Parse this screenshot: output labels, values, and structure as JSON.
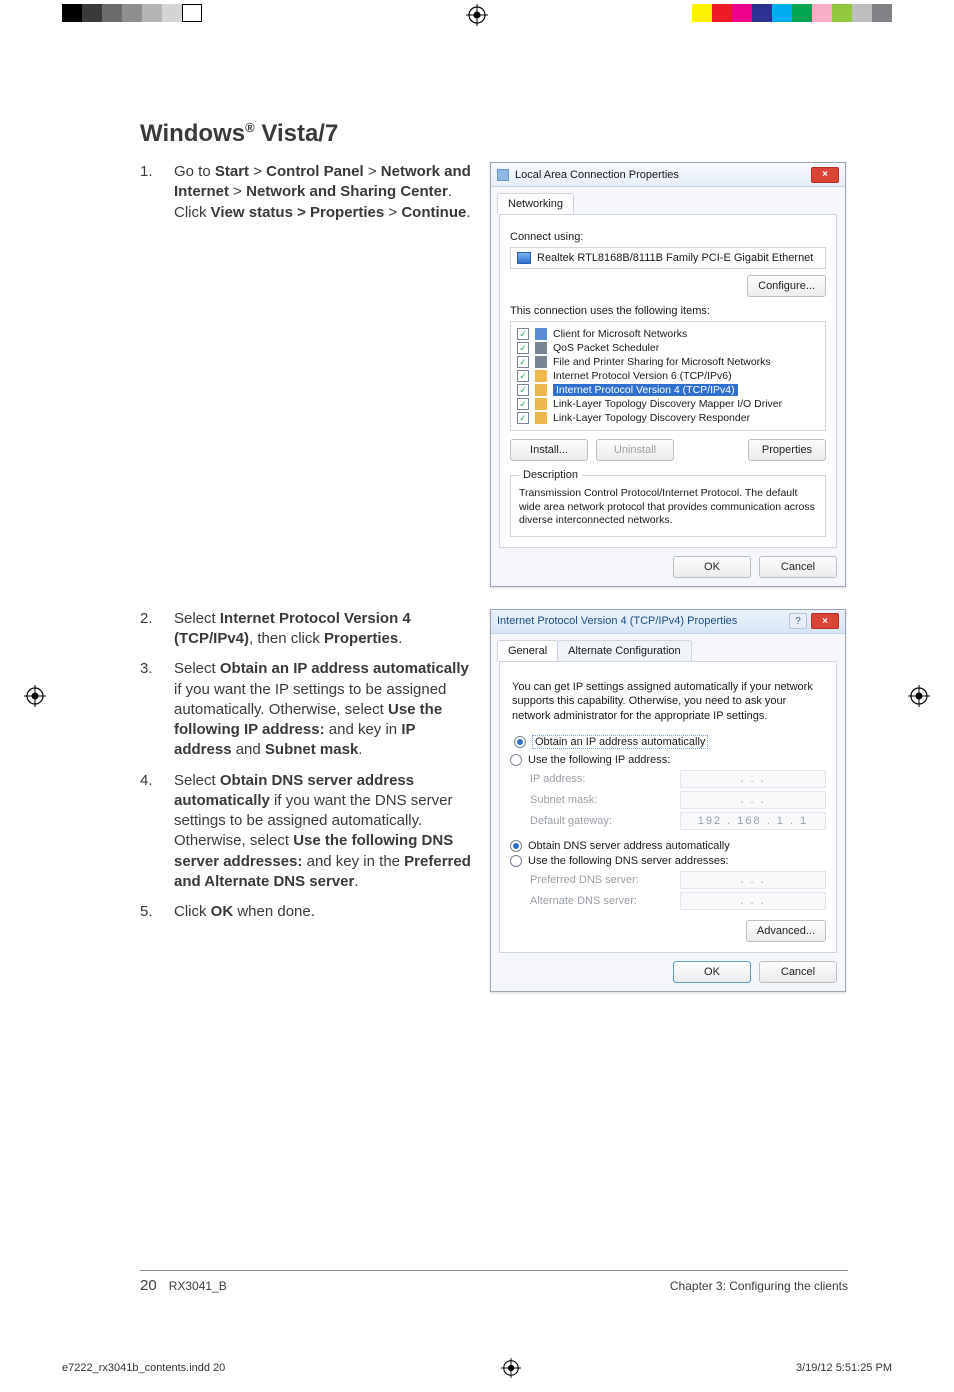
{
  "heading": {
    "text_pre": "Windows",
    "reg": "®",
    "text_post": " Vista/7"
  },
  "steps": [
    {
      "pre": "Go to ",
      "seq": [
        "Start",
        " > ",
        "Control Panel",
        " > ",
        "Network and Internet",
        " > ",
        "Network and Sharing Center"
      ],
      "post1": ". Click ",
      "b1": "View status > Properties",
      "post2": " > ",
      "b2": "Continue",
      "tail": "."
    },
    {
      "pre": "Select ",
      "b1": "Internet Protocol Version 4 (TCP/IPv4)",
      "mid": ", then click ",
      "b2": "Properties",
      "tail": "."
    },
    {
      "pre": "Select ",
      "b1": "Obtain an IP address automatically",
      "mid": " if you want the IP settings to be assigned automatically. Otherwise, select ",
      "b2": "Use the following IP address:",
      "mid2": " and key in ",
      "b3": "IP address",
      "mid3": " and ",
      "b4": "Subnet mask",
      "tail": "."
    },
    {
      "pre": "Select ",
      "b1": "Obtain DNS server address automatically",
      "mid": " if you want the DNS server settings to be assigned automatically. Otherwise, select ",
      "b2": "Use the following DNS server addresses:",
      "mid2": " and key in the ",
      "b3": "Preferred and Alternate DNS server",
      "tail": "."
    },
    {
      "pre": "Click ",
      "b1": "OK",
      "tail": " when done."
    }
  ],
  "shot1": {
    "title": "Local Area Connection Properties",
    "tab": "Networking",
    "connect_using": "Connect using:",
    "nic": "Realtek RTL8168B/8111B Family PCI-E Gigabit Ethernet",
    "configure": "Configure...",
    "uses_items": "This connection uses the following items:",
    "items": [
      "Client for Microsoft Networks",
      "QoS Packet Scheduler",
      "File and Printer Sharing for Microsoft Networks",
      "Internet Protocol Version 6 (TCP/IPv6)",
      "Internet Protocol Version 4 (TCP/IPv4)",
      "Link-Layer Topology Discovery Mapper I/O Driver",
      "Link-Layer Topology Discovery Responder"
    ],
    "install": "Install...",
    "uninstall": "Uninstall",
    "properties": "Properties",
    "desc_legend": "Description",
    "desc": "Transmission Control Protocol/Internet Protocol. The default wide area network protocol that provides communication across diverse interconnected networks.",
    "ok": "OK",
    "cancel": "Cancel"
  },
  "shot2": {
    "title": "Internet Protocol Version 4 (TCP/IPv4) Properties",
    "tab1": "General",
    "tab2": "Alternate Configuration",
    "paragraph": "You can get IP settings assigned automatically if your network supports this capability. Otherwise, you need to ask your network administrator for the appropriate IP settings.",
    "r_auto_ip": "Obtain an IP address automatically",
    "r_use_ip": "Use the following IP address:",
    "ip_address": "IP address:",
    "subnet": "Subnet mask:",
    "gateway": "Default gateway:",
    "gateway_val": "192 . 168 .  1  .  1",
    "r_auto_dns": "Obtain DNS server address automatically",
    "r_use_dns": "Use the following DNS server addresses:",
    "pref_dns": "Preferred DNS server:",
    "alt_dns": "Alternate DNS server:",
    "advanced": "Advanced...",
    "ok": "OK",
    "cancel": "Cancel",
    "dots": ".     .     ."
  },
  "footer": {
    "page": "20",
    "doc": "RX3041_B",
    "chapter": "Chapter 3: Configuring the clients"
  },
  "imposition": {
    "file": "e7222_rx3041b_contents.indd   20",
    "stamp": "3/19/12   5:51:25 PM"
  },
  "colors": {
    "left": [
      "#000000",
      "#3a3a3a",
      "#6b6b6b",
      "#8f8f8f",
      "#b5b5b5",
      "#d4d4d4",
      "#ffffff"
    ],
    "right": [
      "#fff200",
      "#ed1c24",
      "#ec008c",
      "#2e3192",
      "#00aeef",
      "#00a651",
      "#f7adc3",
      "#92c83e",
      "#bcbec0",
      "#808285"
    ]
  }
}
